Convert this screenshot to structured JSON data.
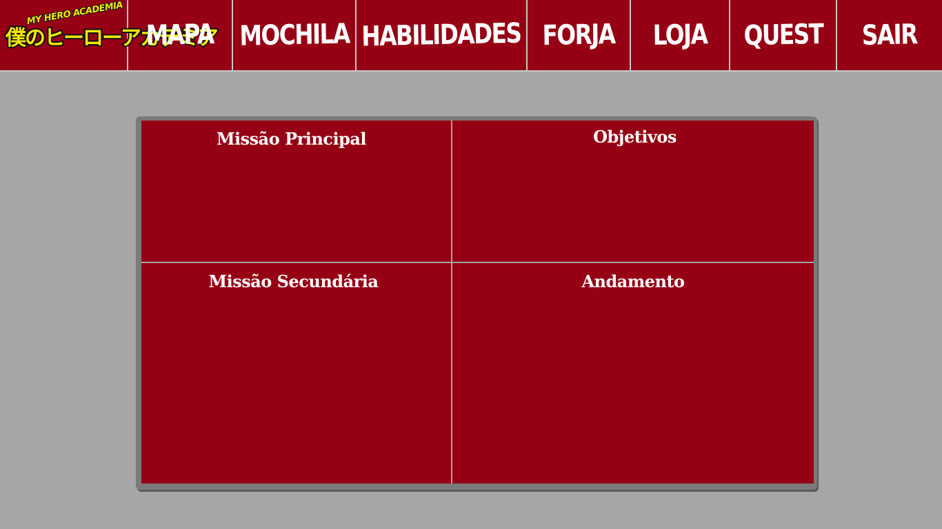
{
  "logo": {
    "top_text": "MY HERO ACADEMIA",
    "main_text": "僕のヒーローアカデミア"
  },
  "nav": {
    "items": [
      {
        "label": "MAPA"
      },
      {
        "label": "MOCHILA"
      },
      {
        "label": "HABILIDADES"
      },
      {
        "label": "FORJA"
      },
      {
        "label": "LOJA"
      },
      {
        "label": "QUEST"
      },
      {
        "label": "SAIR"
      }
    ]
  },
  "quest_panel": {
    "main_mission": "Missão Principal",
    "objectives": "Objetivos",
    "side_mission": "Missão Secundária",
    "progress": "Andamento"
  },
  "colors": {
    "primary": "#960014",
    "background": "#a6a6a6",
    "logo_yellow": "#f5e60a"
  }
}
